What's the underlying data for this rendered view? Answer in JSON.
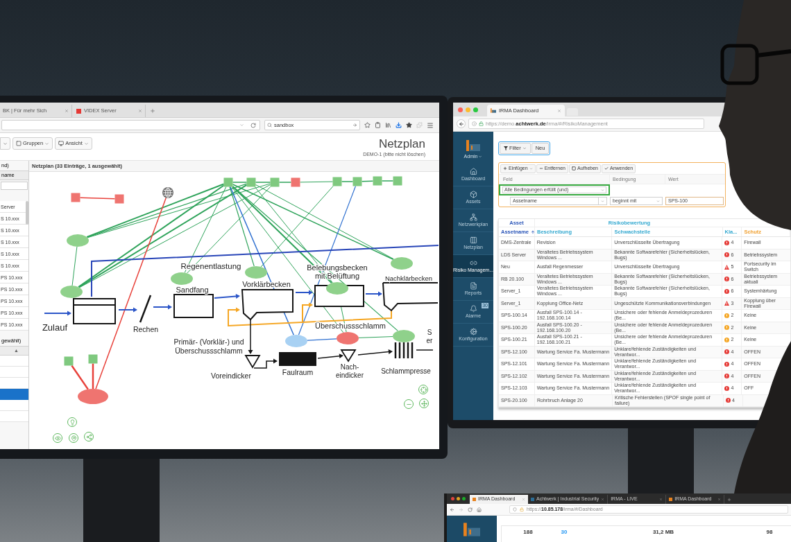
{
  "left_monitor": {
    "browser": {
      "tabs": [
        {
          "label": "BK | Für mehr Sich"
        },
        {
          "label": "VIDEX Server",
          "color": "#e53935"
        }
      ],
      "search": "sandbox"
    },
    "toolbar_buttons": [
      {
        "label": "Gruppen",
        "kind": "groups"
      },
      {
        "label": "Ansicht",
        "kind": "view"
      }
    ],
    "title": "Netzplan",
    "subtitle": "DEMO-1 (bitte nicht löschen)",
    "asset_panel": {
      "title": "nd)",
      "column": "name",
      "rows": [
        "Server",
        "S 10.xxx",
        "S 10.xxx",
        "S 10.xxx",
        "S 10.xxx",
        "S 10.xxx",
        "PS 10.xxx",
        "PS 10.xxx",
        "PS 10.xxx",
        "PS 10.xxx",
        "PS 10.xxx"
      ]
    },
    "selection_panel": {
      "title": "gewählt)",
      "sort_mark": "▲",
      "rows": [
        {
          "selected": false
        },
        {
          "selected": false
        },
        {
          "selected": false
        },
        {
          "selected": true
        },
        {
          "selected": false
        },
        {
          "selected": false
        }
      ]
    },
    "diagram": {
      "title": "Netzplan (33 Einträge, 1 ausgewählt)",
      "labels": [
        {
          "lines": [
            "Regenentlastung"
          ]
        },
        {
          "lines": [
            "Belebungsbecken",
            "mit Belüftung"
          ]
        },
        {
          "lines": [
            "Nachklärbecken"
          ]
        },
        {
          "lines": [
            "Vorklärbecken"
          ]
        },
        {
          "lines": [
            "Sandfang"
          ]
        },
        {
          "lines": [
            "Zulauf"
          ]
        },
        {
          "lines": [
            "Rechen"
          ]
        },
        {
          "lines": [
            "Überschussschlamm"
          ]
        },
        {
          "lines": [
            "S",
            "er"
          ]
        },
        {
          "lines": [
            "Primär- (Vorklär-) und",
            "Überschussschlamm"
          ]
        },
        {
          "lines": [
            "Voreindicker"
          ]
        },
        {
          "lines": [
            "Faulraum"
          ]
        },
        {
          "lines": [
            "Nach-",
            "eindicker"
          ]
        },
        {
          "lines": [
            "Schlammpresse"
          ]
        }
      ],
      "nodes": [
        {
          "kind": "square",
          "color": "#7fc97f"
        },
        {
          "kind": "square",
          "color": "#7fc97f"
        },
        {
          "kind": "square",
          "color": "#7fc97f"
        },
        {
          "kind": "square",
          "color": "#ef7470"
        },
        {
          "kind": "square",
          "color": "#7fc97f"
        },
        {
          "kind": "square",
          "color": "#7fc97f"
        },
        {
          "kind": "square",
          "color": "#7fc97f"
        },
        {
          "kind": "square",
          "color": "#7fc97f"
        },
        {
          "kind": "square",
          "color": "#ef7470"
        },
        {
          "kind": "square",
          "color": "#ef7470"
        },
        {
          "kind": "globe",
          "color": "#6e6e6e"
        },
        {
          "kind": "ellipse",
          "color": "#8fd18b"
        },
        {
          "kind": "ellipse",
          "color": "#8fd18b"
        },
        {
          "kind": "ellipse",
          "color": "#8fd18b"
        },
        {
          "kind": "ellipse",
          "color": "#8fd18b"
        },
        {
          "kind": "ellipse",
          "color": "#8fd18b"
        },
        {
          "kind": "ellipse",
          "color": "#8fd18b"
        },
        {
          "kind": "ellipse",
          "color": "#8fd18b"
        },
        {
          "kind": "ellipse",
          "color": "#a8d1f3"
        },
        {
          "kind": "ellipse",
          "color": "#ef7470"
        },
        {
          "kind": "square",
          "color": "#7fc97f"
        },
        {
          "kind": "square",
          "color": "#7fc97f"
        },
        {
          "kind": "ellipse",
          "color": "#ef7470"
        }
      ]
    }
  },
  "right_monitor": {
    "browser": {
      "tab": "IRMA Dashboard",
      "url": "https://demo.**achtwerk.de**/irma/#/RisikoManagement"
    },
    "sidebar": {
      "user": "Admin",
      "items": [
        {
          "label": "Dashboard",
          "kind": "dashboard",
          "selected": false
        },
        {
          "label": "Assets",
          "kind": "assets",
          "selected": false
        },
        {
          "label": "Netzwerkplan",
          "kind": "topology",
          "selected": false
        },
        {
          "label": "Netzplan",
          "kind": "netplan",
          "selected": false
        },
        {
          "label": "Risiko Managem...",
          "kind": "risk",
          "selected": true
        },
        {
          "label": "Reports",
          "kind": "reports",
          "selected": false
        },
        {
          "label": "Alarme",
          "kind": "alarms",
          "badge": "30",
          "selected": false
        },
        {
          "label": "Konfiguration",
          "kind": "config",
          "selected": false
        }
      ]
    },
    "filter_buttons": [
      {
        "label": "Filter",
        "kind": "menu"
      },
      {
        "label": "Neu",
        "kind": "plain"
      }
    ],
    "filter": {
      "actions": [
        {
          "label": "Einfügen",
          "kind": "add"
        },
        {
          "label": "Entfernen",
          "kind": "remove"
        },
        {
          "label": "Aufheben",
          "kind": "ungroup"
        },
        {
          "label": "Anwenden",
          "kind": "apply"
        }
      ],
      "columns": [
        "Feld",
        "Bedingung",
        "Wert"
      ],
      "group": "Alle Bedingungen erfüllt (und)",
      "rule": {
        "field": "Assetname",
        "condition": "beginnt mit",
        "value": "SPS-100"
      }
    },
    "table": {
      "groups": [
        {
          "label": "Asset",
          "color": "#2a55b8"
        },
        {
          "label": "Risikobewertung",
          "color": "#35a9d0"
        }
      ],
      "columns": [
        {
          "label": "Assetname",
          "color": "#2a55b8",
          "sorted": true
        },
        {
          "label": "Beschreibung",
          "color": "#35a9d0",
          "sorted": false
        },
        {
          "label": "Schwachstelle",
          "color": "#35a9d0",
          "sorted": false
        },
        {
          "label": "Kla...",
          "color": "#35a9d0",
          "sorted": false
        },
        {
          "label": "Schutz",
          "color": "#f0a030",
          "sorted": false
        }
      ],
      "rows": [
        {
          "asset": "DMS-Zentrale",
          "description": "Revision",
          "weakness": "Unverschlüsselte Übertragung",
          "risk": {
            "value": "4",
            "kind": "circle",
            "color": "#e53935"
          },
          "protection": "Firewall"
        },
        {
          "asset": "LDS Server",
          "description": "Veraltetes Betriebssystem Windows ...",
          "weakness": "Bekannte Softwarefehler (Sicherheitslücken, Bugs)",
          "risk": {
            "value": "6",
            "kind": "circle",
            "color": "#e53935"
          },
          "protection": "Betriebssystem"
        },
        {
          "asset": "Neu",
          "description": "Ausfall Regenmesser",
          "weakness": "Unverschlüsselte Übertragung",
          "risk": {
            "value": "5",
            "kind": "triangle",
            "color": "#e53935"
          },
          "protection": "Portsecurity im Switch"
        },
        {
          "asset": "RB 20.100",
          "description": "Veraltetes Betriebssystem Windows ...",
          "weakness": "Bekannte Softwarefehler (Sicherheitslücken, Bugs)",
          "risk": {
            "value": "6",
            "kind": "circle",
            "color": "#e53935"
          },
          "protection": "Betriebssystem aktuali"
        },
        {
          "asset": "Server_1",
          "description": "Veraltetes Betriebssystem Windows ...",
          "weakness": "Bekannte Softwarefehler (Sicherheitslücken, Bugs)",
          "risk": {
            "value": "6",
            "kind": "circle",
            "color": "#e53935"
          },
          "protection": "Systemhärtung"
        },
        {
          "asset": "Server_1",
          "description": "Kopplung Office-Netz",
          "weakness": "Ungeschützte Kommunikationsverbindungen",
          "risk": {
            "value": "3",
            "kind": "triangle",
            "color": "#e53935"
          },
          "protection": "Kopplung über Firewall"
        },
        {
          "asset": "SPS-100.14",
          "description": "Ausfall SPS-100.14 - 192.168.100.14",
          "weakness": "Unsichere oder fehlende Anmeldeprozeduren (Be...",
          "risk": {
            "value": "2",
            "kind": "circle",
            "color": "#f5a623"
          },
          "protection": "Keine"
        },
        {
          "asset": "SPS-100.20",
          "description": "Ausfall SPS-100.20 - 192.168.100.20",
          "weakness": "Unsichere oder fehlende Anmeldeprozeduren (Be...",
          "risk": {
            "value": "2",
            "kind": "circle",
            "color": "#f5a623"
          },
          "protection": "Keine"
        },
        {
          "asset": "SPS-100.21",
          "description": "Ausfall SPS-100.21 - 192.168.100.21",
          "weakness": "Unsichere oder fehlende Anmeldeprozeduren (Be...",
          "risk": {
            "value": "2",
            "kind": "circle",
            "color": "#f5a623"
          },
          "protection": "Keine"
        },
        {
          "asset": "SPS-12.100",
          "description": "Wartung Service Fa. Mustermann",
          "weakness": "Unklare/fehlende Zuständigkeiten und Verantwor...",
          "risk": {
            "value": "4",
            "kind": "circle",
            "color": "#e53935"
          },
          "protection": "OFFEN"
        },
        {
          "asset": "SPS-12.101",
          "description": "Wartung Service Fa. Mustermann",
          "weakness": "Unklare/fehlende Zuständigkeiten und Verantwor...",
          "risk": {
            "value": "4",
            "kind": "circle",
            "color": "#e53935"
          },
          "protection": "OFFEN"
        },
        {
          "asset": "SPS-12.102",
          "description": "Wartung Service Fa. Mustermann",
          "weakness": "Unklare/fehlende Zuständigkeiten und Verantwor...",
          "risk": {
            "value": "4",
            "kind": "circle",
            "color": "#e53935"
          },
          "protection": "OFFEN"
        },
        {
          "asset": "SPS-12.103",
          "description": "Wartung Service Fa. Mustermann",
          "weakness": "Unklare/fehlende Zuständigkeiten und Verantwor...",
          "risk": {
            "value": "4",
            "kind": "circle",
            "color": "#e53935"
          },
          "protection": "OFF"
        },
        {
          "asset": "SPS-20.100",
          "description": "Rohrbruch Anlage 20",
          "weakness": "Kritische Fehlerstellen (SPOF single point of failure)",
          "risk": {
            "value": "4",
            "kind": "circle",
            "color": "#e53935"
          }
        }
      ]
    }
  },
  "bottom_screen": {
    "tabs": [
      {
        "label": "IRMA Dashboard",
        "color": "#e8821e",
        "selected": true
      },
      {
        "label": "Achtwerk | Industrial Security",
        "color": "#2b6c96",
        "selected": false
      },
      {
        "label": "IRMA - LIVE",
        "selected": false
      },
      {
        "label": "IRMA Dashboard",
        "color": "#e8821e",
        "selected": false
      }
    ],
    "url": "https://**10.85.178**/irma/#/Dashboard",
    "stats": [
      {
        "value": "188",
        "color": "#333333"
      },
      {
        "value": "30",
        "color": "#2196f3"
      },
      {
        "value": "31,2 MB",
        "color": "#333333"
      },
      {
        "value": "98",
        "color": "#333333"
      }
    ]
  }
}
